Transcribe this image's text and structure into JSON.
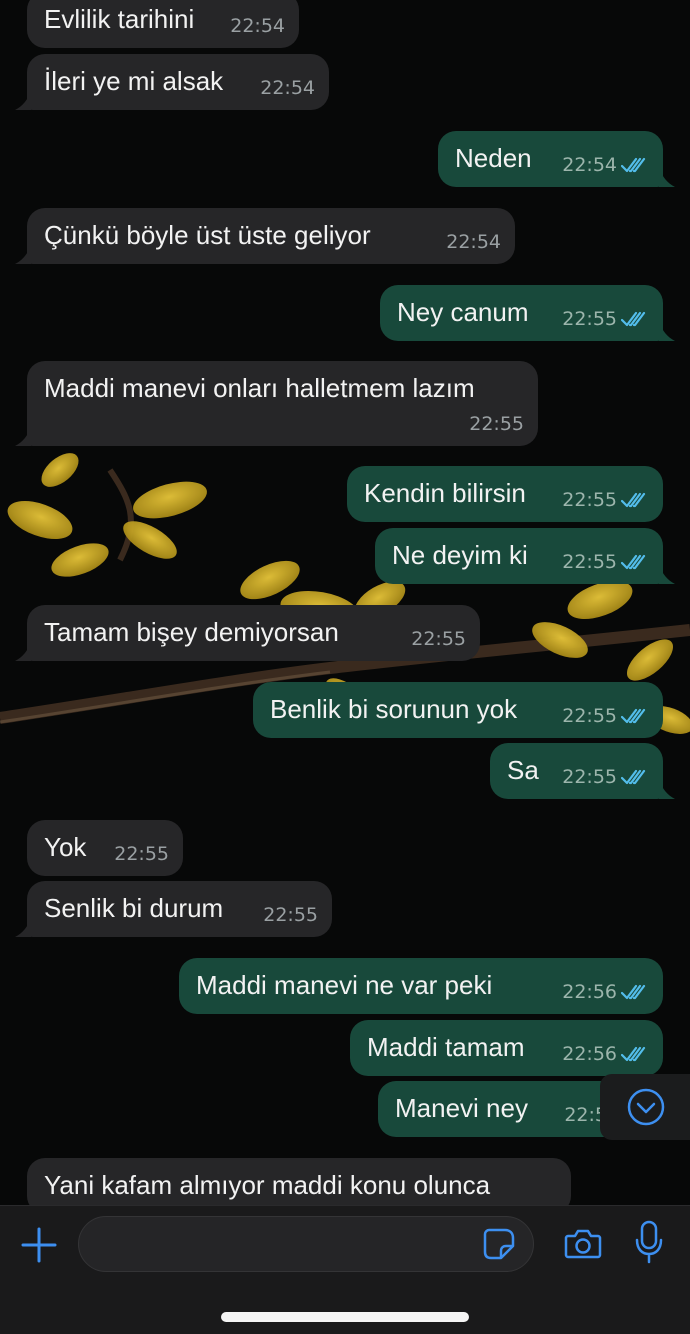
{
  "messages": [
    {
      "text": "Evlilik tarihini",
      "time": "22:54",
      "dir": "in"
    },
    {
      "text": "İleri ye mi alsak",
      "time": "22:54",
      "dir": "in"
    },
    {
      "text": "Neden",
      "time": "22:54",
      "dir": "out",
      "status": "read"
    },
    {
      "text": "Çünkü böyle üst üste geliyor",
      "time": "22:54",
      "dir": "in"
    },
    {
      "text": "Ney canum",
      "time": "22:55",
      "dir": "out",
      "status": "read"
    },
    {
      "text": "Maddi manevi onları halletmem lazım",
      "time": "22:55",
      "dir": "in"
    },
    {
      "text": "Kendin bilirsin",
      "time": "22:55",
      "dir": "out",
      "status": "read"
    },
    {
      "text": "Ne deyim ki",
      "time": "22:55",
      "dir": "out",
      "status": "read"
    },
    {
      "text": "Tamam bişey demiyorsan",
      "time": "22:55",
      "dir": "in"
    },
    {
      "text": "Benlik bi sorunun yok",
      "time": "22:55",
      "dir": "out",
      "status": "read"
    },
    {
      "text": "Sa",
      "time": "22:55",
      "dir": "out",
      "status": "read"
    },
    {
      "text": "Yok",
      "time": "22:55",
      "dir": "in"
    },
    {
      "text": "Senlik bi durum",
      "time": "22:55",
      "dir": "in"
    },
    {
      "text": "Maddi manevi ne var peki",
      "time": "22:56",
      "dir": "out",
      "status": "read"
    },
    {
      "text": "Maddi tamam",
      "time": "22:56",
      "dir": "out",
      "status": "read"
    },
    {
      "text": "Manevi ney",
      "time": "22:5",
      "dir": "out"
    },
    {
      "text": "Yani kafam almıyor maddi konu olunca",
      "time": "",
      "dir": "in"
    }
  ],
  "composer": {
    "input_value": "",
    "icons": [
      "plus-icon",
      "sticker-icon",
      "camera-icon",
      "microphone-icon"
    ]
  },
  "scroll_button_icon": "chevron-down-circle-icon",
  "colors": {
    "incoming_bubble": "#262628",
    "outgoing_bubble": "#18493b",
    "read_ticks": "#53bdeb",
    "accent": "#3d8ff0",
    "background": "#070808"
  }
}
